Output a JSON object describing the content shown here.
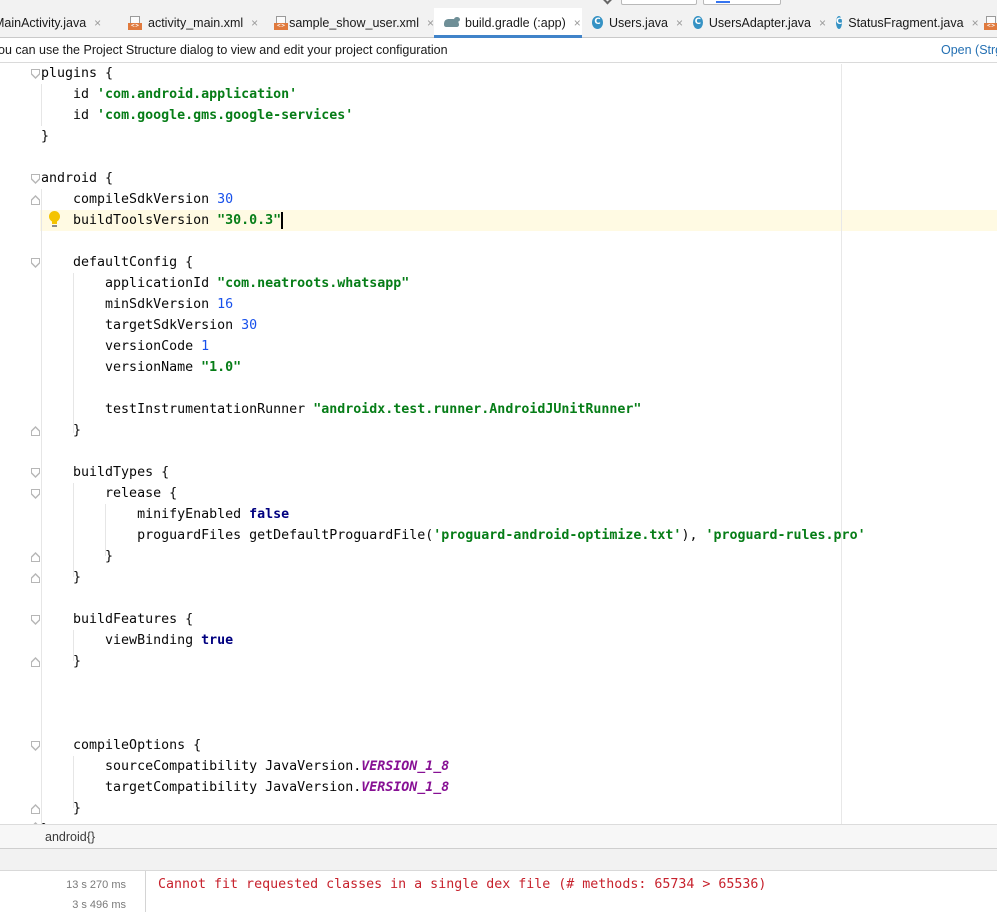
{
  "tabs": [
    {
      "label": "MainActivity.java",
      "icon": "java-class-icon",
      "active": false
    },
    {
      "label": "activity_main.xml",
      "icon": "xml-file-icon",
      "active": false
    },
    {
      "label": "sample_show_user.xml",
      "icon": "xml-file-icon",
      "active": false
    },
    {
      "label": "build.gradle (:app)",
      "icon": "gradle-icon",
      "active": true
    },
    {
      "label": "Users.java",
      "icon": "java-class-icon",
      "active": false
    },
    {
      "label": "UsersAdapter.java",
      "icon": "java-class-icon",
      "active": false
    },
    {
      "label": "StatusFragment.java",
      "icon": "java-class-icon",
      "active": false
    }
  ],
  "tab_close_glyph": "×",
  "class_icon_letter": "C",
  "xml_icon_text": "<>",
  "banner": {
    "message": "ou can use the Project Structure dialog to view and edit your project configuration",
    "action": "Open (Strg"
  },
  "editor": {
    "current_line_index": 7,
    "lines": [
      [
        [
          "plain",
          "plugins {"
        ]
      ],
      [
        [
          "plain",
          "    id "
        ],
        [
          "str",
          "'com.android.application'"
        ]
      ],
      [
        [
          "plain",
          "    id "
        ],
        [
          "str",
          "'com.google.gms.google-services'"
        ]
      ],
      [
        [
          "plain",
          "}"
        ]
      ],
      [],
      [
        [
          "plain",
          "android {"
        ]
      ],
      [
        [
          "plain",
          "    compileSdkVersion "
        ],
        [
          "num",
          "30"
        ]
      ],
      [
        [
          "plain",
          "    buildToolsVersion "
        ],
        [
          "str",
          "\"30.0.3\""
        ]
      ],
      [],
      [
        [
          "plain",
          "    defaultConfig {"
        ]
      ],
      [
        [
          "plain",
          "        applicationId "
        ],
        [
          "str",
          "\"com.neatroots.whatsapp\""
        ]
      ],
      [
        [
          "plain",
          "        minSdkVersion "
        ],
        [
          "num",
          "16"
        ]
      ],
      [
        [
          "plain",
          "        targetSdkVersion "
        ],
        [
          "num",
          "30"
        ]
      ],
      [
        [
          "plain",
          "        versionCode "
        ],
        [
          "num",
          "1"
        ]
      ],
      [
        [
          "plain",
          "        versionName "
        ],
        [
          "str",
          "\"1.0\""
        ]
      ],
      [],
      [
        [
          "plain",
          "        testInstrumentationRunner "
        ],
        [
          "str",
          "\"androidx.test.runner.AndroidJUnitRunner\""
        ]
      ],
      [
        [
          "plain",
          "    }"
        ]
      ],
      [],
      [
        [
          "plain",
          "    buildTypes {"
        ]
      ],
      [
        [
          "plain",
          "        release {"
        ]
      ],
      [
        [
          "plain",
          "            minifyEnabled "
        ],
        [
          "kw",
          "false"
        ]
      ],
      [
        [
          "plain",
          "            proguardFiles getDefaultProguardFile("
        ],
        [
          "str",
          "'proguard-android-optimize.txt'"
        ],
        [
          "plain",
          "), "
        ],
        [
          "str",
          "'proguard-rules.pro'"
        ]
      ],
      [
        [
          "plain",
          "        }"
        ]
      ],
      [
        [
          "plain",
          "    }"
        ]
      ],
      [],
      [
        [
          "plain",
          "    buildFeatures {"
        ]
      ],
      [
        [
          "plain",
          "        viewBinding "
        ],
        [
          "kw",
          "true"
        ]
      ],
      [
        [
          "plain",
          "    }"
        ]
      ],
      [],
      [],
      [],
      [
        [
          "plain",
          "    compileOptions {"
        ]
      ],
      [
        [
          "plain",
          "        sourceCompatibility JavaVersion."
        ],
        [
          "const",
          "VERSION_1_8"
        ]
      ],
      [
        [
          "plain",
          "        targetCompatibility JavaVersion."
        ],
        [
          "const",
          "VERSION_1_8"
        ]
      ],
      [
        [
          "plain",
          "    }"
        ]
      ],
      [
        [
          "plain",
          "}"
        ]
      ]
    ]
  },
  "breadcrumb": "android{}",
  "build": {
    "timings": [
      "13 s 270 ms",
      "3 s 496 ms"
    ],
    "error": "Cannot fit requested classes in a single dex file (# methods: 65734 > 65536)"
  },
  "colors": {
    "keyword": "#000080",
    "string": "#067d17",
    "number": "#1750eb",
    "constant": "#871094",
    "error": "#c7222d",
    "accent": "#4083c9"
  }
}
